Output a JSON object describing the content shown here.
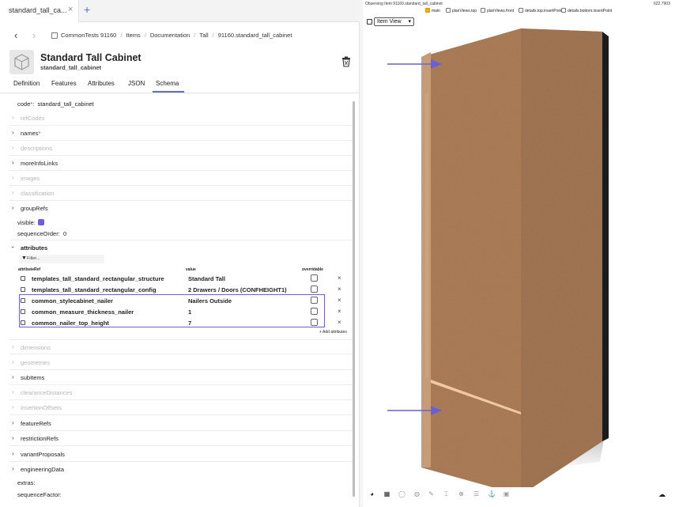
{
  "tabbar": {
    "tab_label": "standard_tall_ca...",
    "close_glyph": "×",
    "add_glyph": "+"
  },
  "nav": {
    "back_glyph": "‹",
    "forward_glyph": "›",
    "breadcrumbs": [
      "CommonTests 91160",
      "Items",
      "Documentation",
      "Tall",
      "91160.standard_tall_cabinet"
    ]
  },
  "header": {
    "title": "Standard Tall Cabinet",
    "subtitle": "standard_tall_cabinet"
  },
  "subtabs": [
    "Definition",
    "Features",
    "Attributes",
    "JSON",
    "Schema"
  ],
  "schema": {
    "code_label": "code",
    "code_value": "standard_tall_cabinet",
    "required_mark": "*",
    "rows_top": [
      {
        "label": "refCodes",
        "dim": true,
        "required": false
      },
      {
        "label": "names",
        "dim": false,
        "required": true
      },
      {
        "label": "descriptions",
        "dim": true,
        "required": false
      },
      {
        "label": "moreInfoLinks",
        "dim": false,
        "required": false
      },
      {
        "label": "images",
        "dim": true,
        "required": false
      },
      {
        "label": "classification",
        "dim": true,
        "required": false
      },
      {
        "label": "groupRefs",
        "dim": false,
        "required": false
      }
    ],
    "visible_label": "visible:",
    "sequence_order_label": "sequenceOrder:",
    "sequence_order_value": "0",
    "attributes_label": "attributes",
    "filter_placeholder": "Filter...",
    "col_ref": "attributeRef",
    "col_value": "value",
    "col_overridable": "overridable",
    "attributes": [
      {
        "name": "templates_tall_standard_rectangular_structure",
        "value": "Standard Tall"
      },
      {
        "name": "templates_tall_standard_rectangular_config",
        "value": "2 Drawers / Doors (CONFHEIGHT1)"
      },
      {
        "name": "common_stylecabinet_nailer",
        "value": "Nailers Outside"
      },
      {
        "name": "common_measure_thickness_nailer",
        "value": "1"
      },
      {
        "name": "common_nailer_top_height",
        "value": "7"
      }
    ],
    "remove_glyph": "×",
    "add_attribute": "+ Add attributes",
    "rows_bottom": [
      {
        "label": "dimensions",
        "dim": true
      },
      {
        "label": "geometries",
        "dim": true
      },
      {
        "label": "subItems",
        "dim": false
      },
      {
        "label": "clearanceDistances",
        "dim": true
      },
      {
        "label": "insertionOffsets",
        "dim": true
      },
      {
        "label": "featureRefs",
        "dim": false
      },
      {
        "label": "restrictionRefs",
        "dim": false
      },
      {
        "label": "variantProposals",
        "dim": false
      },
      {
        "label": "engineeringData",
        "dim": false
      }
    ],
    "extras_label": "extras:",
    "sequence_factor_label": "sequenceFactor:"
  },
  "viewer": {
    "observing": "Observing Item 91160.standard_tall_cabinet",
    "version": "622.7903",
    "layers": [
      {
        "label": "main",
        "checked": true
      },
      {
        "label": "planViews.top",
        "checked": false
      },
      {
        "label": "planViews.front",
        "checked": false
      },
      {
        "label": "details.top.insertPoint",
        "checked": false
      },
      {
        "label": "details.bottom.insertPoint",
        "checked": false
      }
    ],
    "view_select": "Item View",
    "colors": {
      "accent": "#6c5ce7",
      "cabinet_front": "#9b6e4a",
      "cabinet_side": "#b88761",
      "cabinet_top": "#c79a72",
      "edge_highlight": "#f4c9a3",
      "arrow": "#6a5fd8"
    }
  },
  "toolbar_icons": [
    "palette-icon",
    "grid-icon",
    "circle-icon",
    "sphere-icon",
    "pen-icon",
    "ruler-icon",
    "target-icon",
    "layers-icon",
    "anchor-icon",
    "cube-icon"
  ]
}
